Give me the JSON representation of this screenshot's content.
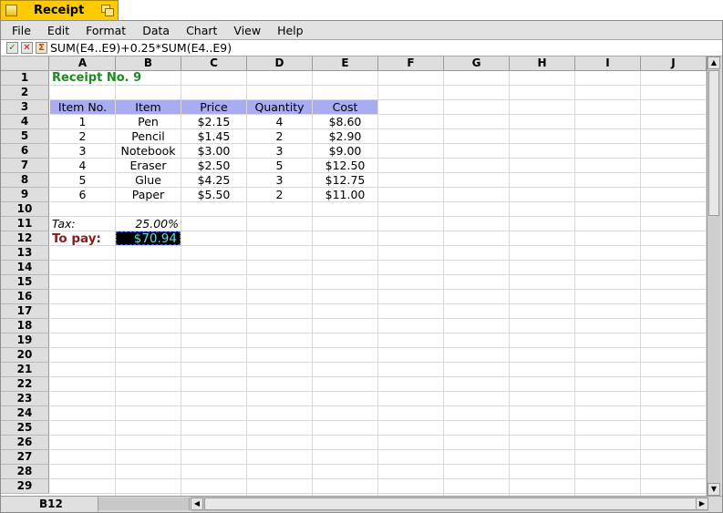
{
  "window": {
    "title": "Receipt"
  },
  "menubar": {
    "items": [
      "File",
      "Edit",
      "Format",
      "Data",
      "Chart",
      "View",
      "Help"
    ]
  },
  "formula_bar": {
    "accept_glyph": "✓",
    "cancel_glyph": "✕",
    "sum_glyph": "Σ",
    "formula": "SUM(E4..E9)+0.25*SUM(E4..E9)"
  },
  "grid": {
    "columns": [
      "A",
      "B",
      "C",
      "D",
      "E",
      "F",
      "G",
      "H",
      "I",
      "J"
    ],
    "rows": [
      "1",
      "2",
      "3",
      "4",
      "5",
      "6",
      "7",
      "8",
      "9",
      "10",
      "11",
      "12",
      "13",
      "14",
      "15",
      "16",
      "17",
      "18",
      "19",
      "20",
      "21",
      "22",
      "23",
      "24",
      "25",
      "26",
      "27",
      "28",
      "29"
    ]
  },
  "sheet": {
    "title": "Receipt No. 9",
    "headers": [
      "Item No.",
      "Item",
      "Price",
      "Quantity",
      "Cost"
    ],
    "items": [
      [
        "1",
        "Pen",
        "$2.15",
        "4",
        "$8.60"
      ],
      [
        "2",
        "Pencil",
        "$1.45",
        "2",
        "$2.90"
      ],
      [
        "3",
        "Notebook",
        "$3.00",
        "3",
        "$9.00"
      ],
      [
        "4",
        "Eraser",
        "$2.50",
        "5",
        "$12.50"
      ],
      [
        "5",
        "Glue",
        "$4.25",
        "3",
        "$12.75"
      ],
      [
        "6",
        "Paper",
        "$5.50",
        "2",
        "$11.00"
      ]
    ],
    "tax_label": "Tax:",
    "tax_value": "25.00%",
    "pay_label": "To pay:",
    "pay_value": "$70.94"
  },
  "status": {
    "cell_ref": "B12"
  },
  "scroll": {
    "left_arrow": "◀",
    "right_arrow": "▶",
    "up_arrow": "▲",
    "down_arrow": "▼"
  },
  "colors": {
    "tab": "#ffcb00",
    "header_fill": "#a9acf0",
    "title": "#1f8a1f",
    "pay_label": "#8b1a1a",
    "pay_value": "#5fe0e0"
  }
}
